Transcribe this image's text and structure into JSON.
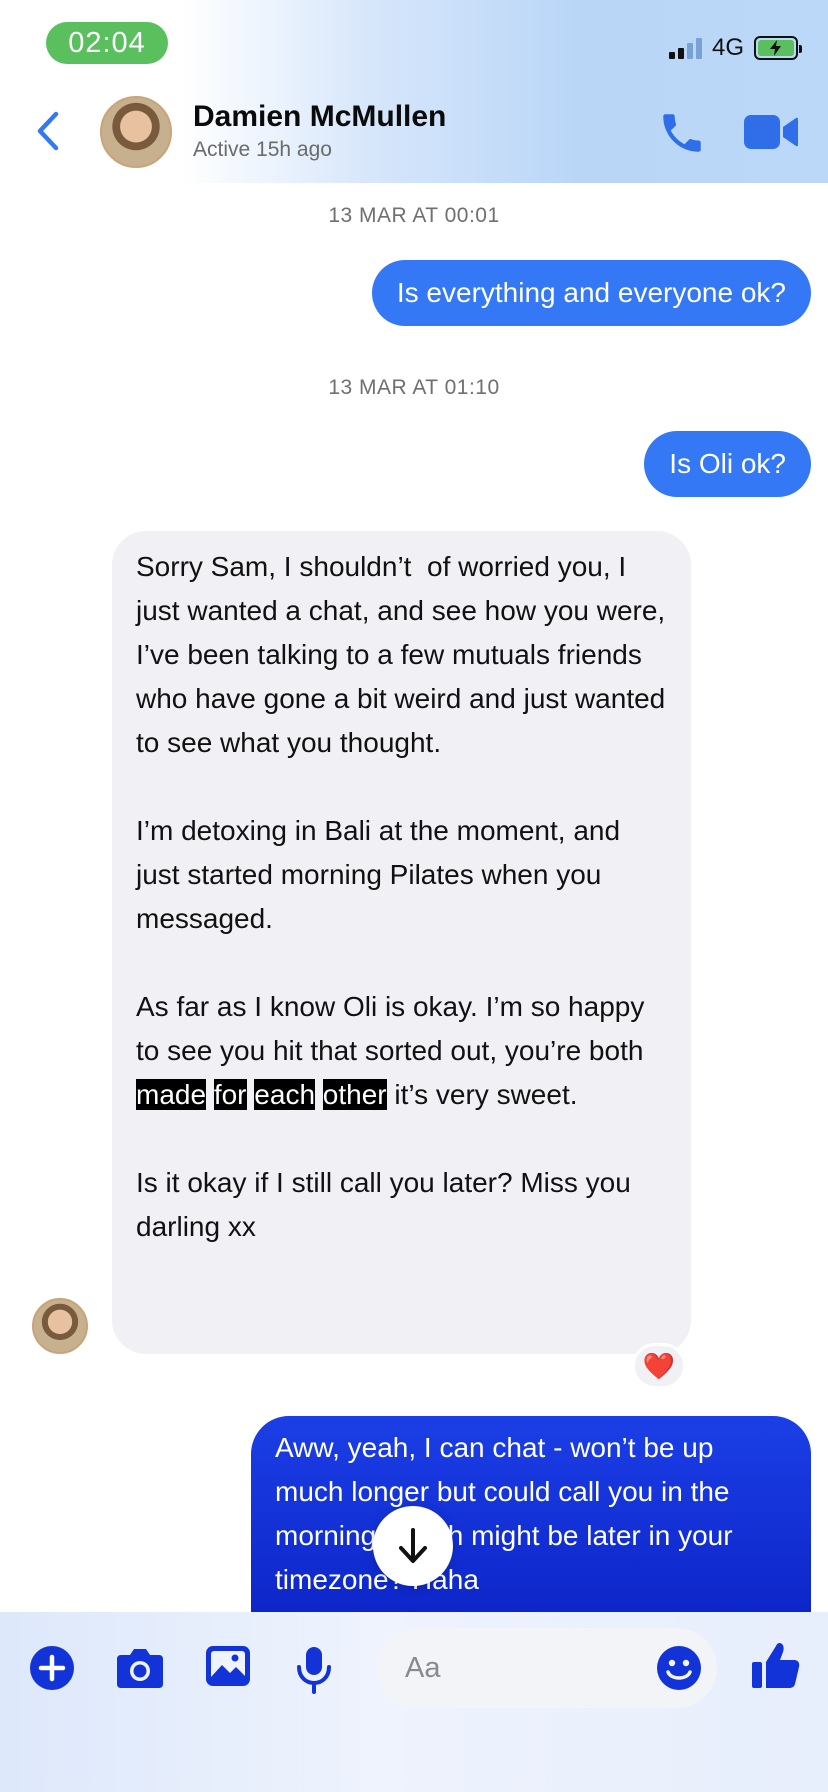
{
  "status_bar": {
    "time": "02:04",
    "network": "4G"
  },
  "header": {
    "contact_name": "Damien McMullen",
    "contact_status": "Active 15h ago"
  },
  "messages": [
    {
      "type": "timestamp",
      "text": "13 MAR AT 00:01"
    },
    {
      "type": "outgoing",
      "text": "Is everything and everyone ok?"
    },
    {
      "type": "timestamp",
      "text": "13 MAR AT 01:10"
    },
    {
      "type": "outgoing",
      "text": "Is Oli ok?"
    },
    {
      "type": "incoming",
      "p1": "Sorry Sam, I shouldn’t  of worried you, I just wanted a chat, and see how you were, I’ve been talking to a few mutuals friends who have gone a bit weird and just wanted to see what you thought.",
      "p2": "I’m detoxing in Bali at the moment, and just started morning Pilates when you messaged.",
      "p3_before": "As far as I know Oli is okay. I’m so happy to see you hit that sorted out, you’re both ",
      "p3_highlight": [
        "made",
        "for",
        "each",
        "other"
      ],
      "p3_after": " it’s very sweet.",
      "p4": "Is it okay if I still call you later? Miss you darling xx",
      "reaction": "❤️"
    },
    {
      "type": "outgoing",
      "text": "Aww, yeah, I can chat - won’t be up much longer but could call you in the morning, which might be later in your timezone? Haha"
    }
  ],
  "composer": {
    "placeholder": "Aa"
  },
  "colors": {
    "accent": "#3478f6",
    "accent_dark": "#1233d8",
    "status_green": "#5ac05e",
    "incoming_bubble": "#f0f0f5"
  },
  "icons": [
    "back-chevron-icon",
    "phone-icon",
    "video-camera-icon",
    "heart-icon",
    "arrow-down-icon",
    "plus-icon",
    "camera-icon",
    "photo-icon",
    "microphone-icon",
    "emoji-icon",
    "thumbs-up-icon"
  ]
}
